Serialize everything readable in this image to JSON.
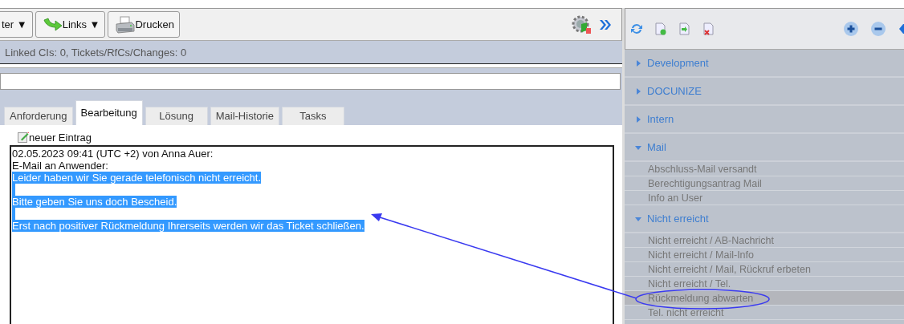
{
  "toolbar": {
    "buttons": [
      {
        "label": "ter ▼",
        "kind": "plain"
      },
      {
        "label": "Links ▼",
        "kind": "link"
      },
      {
        "label": "Drucken",
        "kind": "print"
      }
    ]
  },
  "info_bar": {
    "text": "Linked CIs: 0, Tickets/RfCs/Changes: 0"
  },
  "tabs": [
    {
      "label": "Anforderung",
      "selected": false
    },
    {
      "label": "Bearbeitung",
      "selected": true
    },
    {
      "label": "Lösung",
      "selected": false
    },
    {
      "label": "Mail-Historie",
      "selected": false
    },
    {
      "label": "Tasks",
      "selected": false
    }
  ],
  "new_entry": {
    "label": "neuer Eintrag"
  },
  "entry": {
    "header_lines": [
      "02.05.2023 09:41 (UTC +2) von Anna Auer:",
      "E-Mail an Anwender:"
    ],
    "body_lines": [
      {
        "text": "Leider haben wir Sie gerade telefonisch nicht erreicht.",
        "selected": true
      },
      {
        "text": "Bitte geben Sie uns doch Bescheid.",
        "selected": true
      },
      {
        "text": "Erst nach positiver Rückmeldung Ihrerseits werden wir das Ticket schließen.",
        "selected": true
      }
    ]
  },
  "tree": [
    {
      "label": "Development",
      "expanded": false
    },
    {
      "label": "DOCUNIZE",
      "expanded": false
    },
    {
      "label": "Intern",
      "expanded": false
    },
    {
      "label": "Mail",
      "expanded": true,
      "children": [
        {
          "label": "Abschluss-Mail versandt",
          "selected": false
        },
        {
          "label": "Berechtigungsantrag Mail",
          "selected": false
        },
        {
          "label": "Info an User",
          "selected": false
        }
      ]
    },
    {
      "label": "Nicht erreicht",
      "expanded": true,
      "children": [
        {
          "label": "Nicht erreicht / AB-Nachricht",
          "selected": false
        },
        {
          "label": "Nicht erreicht / Mail-Info",
          "selected": false
        },
        {
          "label": "Nicht erreicht / Mail, Rückruf erbeten",
          "selected": false
        },
        {
          "label": "Nicht erreicht / Tel.",
          "selected": false
        },
        {
          "label": "Rückmeldung abwarten",
          "selected": true
        },
        {
          "label": "Tel. nicht erreicht",
          "selected": false
        }
      ]
    }
  ]
}
